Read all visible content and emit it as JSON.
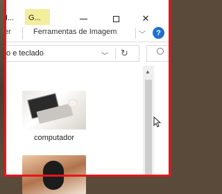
{
  "titlebar": {
    "tab1_label": "I...",
    "tab2_label": "G...",
    "tab2_color": "#f3ee9c",
    "minimize_icon": "minimize-icon",
    "maximize_icon": "maximize-icon",
    "close_icon": "close-icon"
  },
  "ribbon": {
    "view_tab_label": "er",
    "tools_tab_label": "Ferramentas de Imagem",
    "expand_icon": "chevron-down-icon",
    "help_label": "?",
    "help_color": "#1e6fcf"
  },
  "addressbar": {
    "path_text": "to e teclado",
    "dropdown_icon": "chevron-down-icon",
    "refresh_icon": "refresh-icon",
    "search_icon": "search-icon"
  },
  "files": [
    {
      "name": "computador",
      "thumbnail": "laptop-photo"
    },
    {
      "name": "",
      "thumbnail": "mouse-photo"
    }
  ],
  "colors": {
    "frame_highlight": "#e8141b",
    "window_bg": "#ffffff"
  }
}
